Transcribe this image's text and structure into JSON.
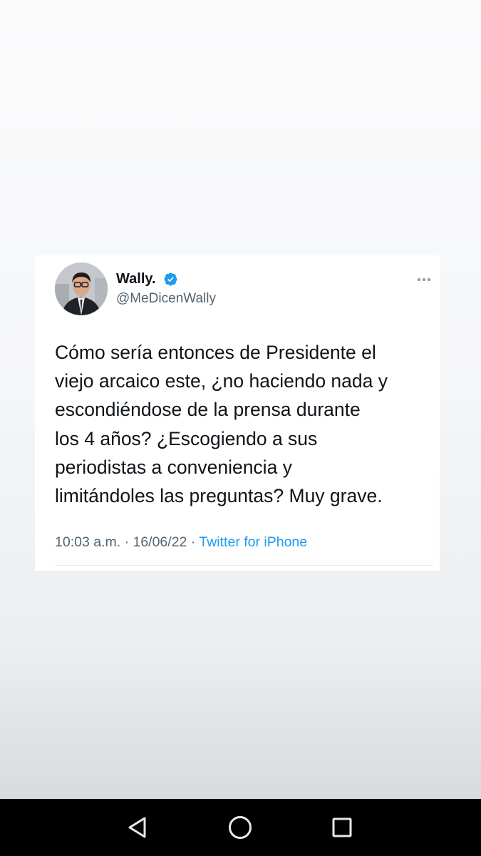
{
  "tweet": {
    "display_name": "Wally.",
    "handle": "@MeDicenWally",
    "verified_icon": "verified-badge-icon",
    "more_icon": "more-options-icon",
    "text_lines": [
      "Cómo sería entonces de Presidente el",
      "viejo arcaico este, ¿no haciendo nada y",
      "escondiéndose de la prensa durante",
      "los 4 años? ¿Escogiendo a sus",
      "periodistas a conveniencia y",
      "limitándoles las preguntas? Muy grave."
    ],
    "time": "10:03 a.m.",
    "date": "16/06/22",
    "separator": "·",
    "source": "Twitter for iPhone",
    "colors": {
      "name": "#0f1419",
      "secondary": "#536471",
      "link": "#1d9bf0",
      "verified": "#1d9bf0"
    }
  },
  "nav_bar": {
    "back_icon": "back-triangle-icon",
    "home_icon": "home-circle-icon",
    "recent_icon": "recent-apps-square-icon",
    "background": "#000000"
  }
}
